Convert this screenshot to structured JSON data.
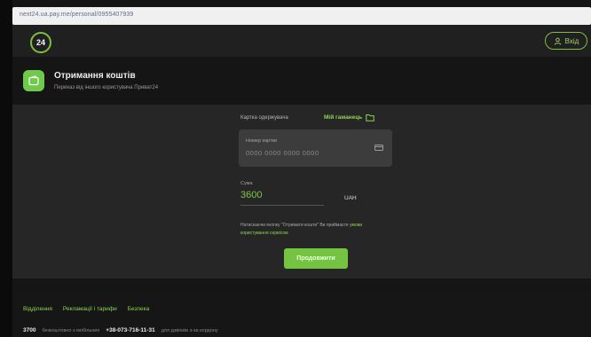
{
  "browser": {
    "url": "next24.ua.pay.me/personal/0955407939"
  },
  "topnav": {
    "logo_text": "24",
    "login_label": "Вхід"
  },
  "header": {
    "title": "Отримання коштів",
    "subtitle": "Переказ від іншого користувача Приват24",
    "icon": "wallet-icon"
  },
  "form": {
    "card_section_label": "Картка одержувача",
    "wallet_link_label": "Мій гаманець",
    "card_number_label": "Номер картки",
    "card_number_placeholder": "0000 0000 0000 0000",
    "amount_label": "Сума",
    "amount_value": "3600",
    "currency": "UAH",
    "disclaimer_text": "Натискаючи кнопку \"Отримати кошти\" Ви приймаєте",
    "disclaimer_link": "умови користування сервісом",
    "continue_label": "Продовжити"
  },
  "footer": {
    "links": [
      "Відділення",
      "Рекламації і тарифи",
      "Безпека"
    ],
    "short_number": "3700",
    "short_number_note": "безкоштовно з мобільних",
    "phone": "+38-073-716-11-31",
    "phone_note": "для дзвінків з-за кордону"
  },
  "colors": {
    "accent": "#74c442",
    "link": "#8ed353",
    "background": "#151515",
    "panel": "#262626"
  }
}
